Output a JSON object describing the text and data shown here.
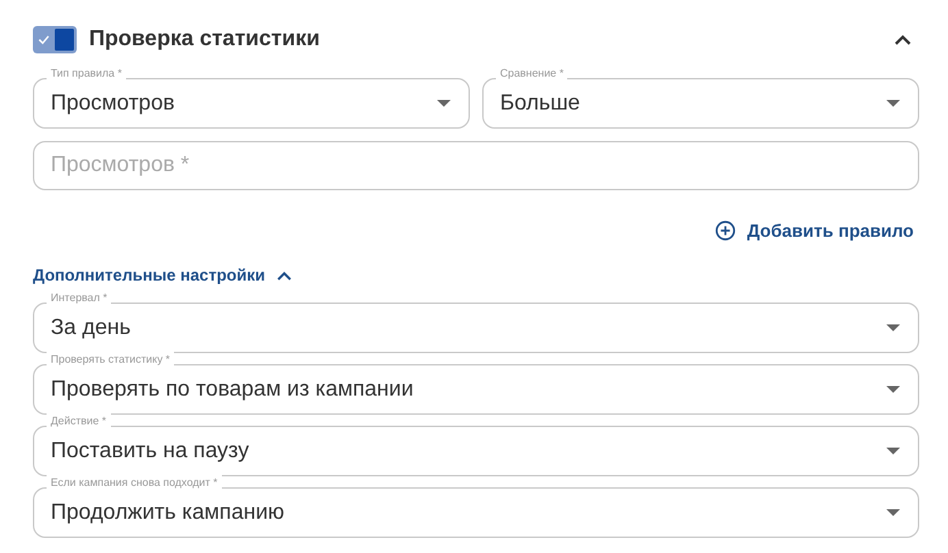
{
  "section": {
    "title": "Проверка статистики",
    "checked": true,
    "expanded": true
  },
  "rule": {
    "fields": [
      {
        "label": "Тип правила *",
        "value": "Просмотров"
      },
      {
        "label": "Сравнение *",
        "value": "Больше"
      }
    ],
    "input": {
      "placeholder": "Просмотров *"
    }
  },
  "add_rule": {
    "label": "Добавить правило"
  },
  "advanced": {
    "title": "Дополнительные настройки",
    "expanded": true,
    "fields": [
      {
        "label": "Интервал *",
        "value": "За день"
      },
      {
        "label": "Проверять статистику *",
        "value": "Проверять по товарам из кампании"
      },
      {
        "label": "Действие *",
        "value": "Поставить на паузу"
      },
      {
        "label": "Если кампания снова подходит *",
        "value": "Продолжить кампанию"
      }
    ]
  }
}
